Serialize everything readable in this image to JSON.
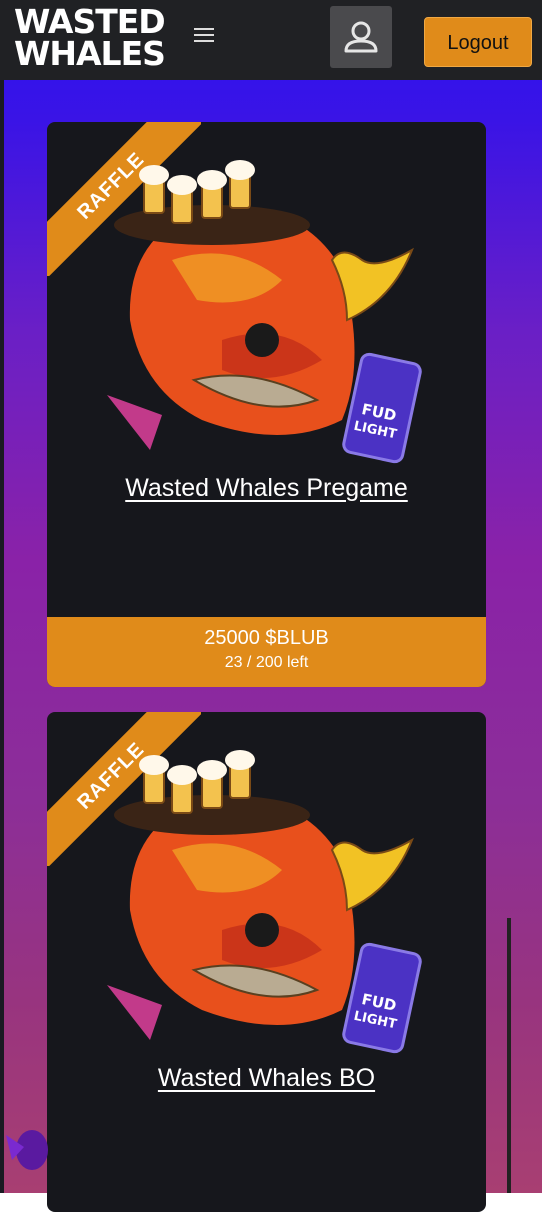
{
  "header": {
    "logo_line1": "WASTED",
    "logo_line2": "WHALES",
    "menu_icon": "hamburger-icon",
    "user_icon": "user-icon",
    "logout_label": "Logout"
  },
  "cards": [
    {
      "ribbon": "RAFFLE",
      "title": "Wasted Whales Pregame",
      "price": "25000  $BLUB",
      "remaining": "23 / 200 left"
    },
    {
      "ribbon": "RAFFLE",
      "title": "Wasted Whales BO"
    }
  ],
  "colors": {
    "accent": "#e08b1a",
    "header": "#202124",
    "card": "#16171c"
  }
}
